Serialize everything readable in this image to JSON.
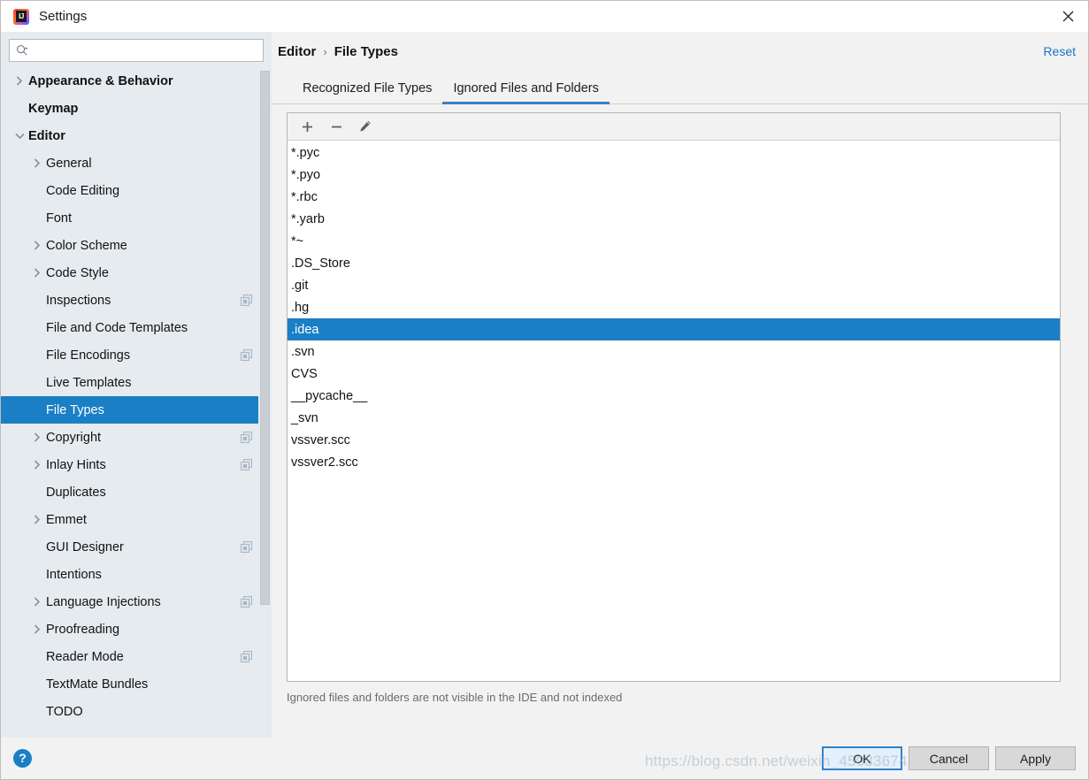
{
  "window": {
    "title": "Settings",
    "logo_icon": "intellij-idea-logo",
    "close_icon": "close-icon"
  },
  "sidebar": {
    "search": {
      "placeholder": "",
      "value": "",
      "icon": "search-icon"
    },
    "items": [
      {
        "label": "Appearance & Behavior",
        "level": 0,
        "chevron": "right",
        "bold": true,
        "selected": false,
        "badge": false
      },
      {
        "label": "Keymap",
        "level": 0,
        "chevron": "none",
        "bold": true,
        "selected": false,
        "badge": false
      },
      {
        "label": "Editor",
        "level": 0,
        "chevron": "down",
        "bold": true,
        "selected": false,
        "badge": false
      },
      {
        "label": "General",
        "level": 1,
        "chevron": "right",
        "bold": false,
        "selected": false,
        "badge": false
      },
      {
        "label": "Code Editing",
        "level": 1,
        "chevron": "none",
        "bold": false,
        "selected": false,
        "badge": false
      },
      {
        "label": "Font",
        "level": 1,
        "chevron": "none",
        "bold": false,
        "selected": false,
        "badge": false
      },
      {
        "label": "Color Scheme",
        "level": 1,
        "chevron": "right",
        "bold": false,
        "selected": false,
        "badge": false
      },
      {
        "label": "Code Style",
        "level": 1,
        "chevron": "right",
        "bold": false,
        "selected": false,
        "badge": false
      },
      {
        "label": "Inspections",
        "level": 1,
        "chevron": "none",
        "bold": false,
        "selected": false,
        "badge": true
      },
      {
        "label": "File and Code Templates",
        "level": 1,
        "chevron": "none",
        "bold": false,
        "selected": false,
        "badge": false
      },
      {
        "label": "File Encodings",
        "level": 1,
        "chevron": "none",
        "bold": false,
        "selected": false,
        "badge": true
      },
      {
        "label": "Live Templates",
        "level": 1,
        "chevron": "none",
        "bold": false,
        "selected": false,
        "badge": false
      },
      {
        "label": "File Types",
        "level": 1,
        "chevron": "none",
        "bold": false,
        "selected": true,
        "badge": false
      },
      {
        "label": "Copyright",
        "level": 1,
        "chevron": "right",
        "bold": false,
        "selected": false,
        "badge": true
      },
      {
        "label": "Inlay Hints",
        "level": 1,
        "chevron": "right",
        "bold": false,
        "selected": false,
        "badge": true
      },
      {
        "label": "Duplicates",
        "level": 1,
        "chevron": "none",
        "bold": false,
        "selected": false,
        "badge": false
      },
      {
        "label": "Emmet",
        "level": 1,
        "chevron": "right",
        "bold": false,
        "selected": false,
        "badge": false
      },
      {
        "label": "GUI Designer",
        "level": 1,
        "chevron": "none",
        "bold": false,
        "selected": false,
        "badge": true
      },
      {
        "label": "Intentions",
        "level": 1,
        "chevron": "none",
        "bold": false,
        "selected": false,
        "badge": false
      },
      {
        "label": "Language Injections",
        "level": 1,
        "chevron": "right",
        "bold": false,
        "selected": false,
        "badge": true
      },
      {
        "label": "Proofreading",
        "level": 1,
        "chevron": "right",
        "bold": false,
        "selected": false,
        "badge": false
      },
      {
        "label": "Reader Mode",
        "level": 1,
        "chevron": "none",
        "bold": false,
        "selected": false,
        "badge": true
      },
      {
        "label": "TextMate Bundles",
        "level": 1,
        "chevron": "none",
        "bold": false,
        "selected": false,
        "badge": false
      },
      {
        "label": "TODO",
        "level": 1,
        "chevron": "none",
        "bold": false,
        "selected": false,
        "badge": false
      }
    ],
    "help_button": {
      "label": "?",
      "icon": "help-icon"
    }
  },
  "main": {
    "breadcrumb": {
      "root": "Editor",
      "separator": "›",
      "current": "File Types"
    },
    "reset_label": "Reset",
    "tabs": [
      {
        "label": "Recognized File Types",
        "active": false
      },
      {
        "label": "Ignored Files and Folders",
        "active": true
      }
    ],
    "toolbar": [
      {
        "name": "add-button",
        "icon": "plus-icon"
      },
      {
        "name": "remove-button",
        "icon": "minus-icon"
      },
      {
        "name": "edit-button",
        "icon": "pencil-icon"
      }
    ],
    "list": {
      "items": [
        {
          "value": "*.pyc",
          "selected": false
        },
        {
          "value": "*.pyo",
          "selected": false
        },
        {
          "value": "*.rbc",
          "selected": false
        },
        {
          "value": "*.yarb",
          "selected": false
        },
        {
          "value": "*~",
          "selected": false
        },
        {
          "value": ".DS_Store",
          "selected": false
        },
        {
          "value": ".git",
          "selected": false
        },
        {
          "value": ".hg",
          "selected": false
        },
        {
          "value": ".idea",
          "selected": true
        },
        {
          "value": ".svn",
          "selected": false
        },
        {
          "value": "CVS",
          "selected": false
        },
        {
          "value": "__pycache__",
          "selected": false
        },
        {
          "value": "_svn",
          "selected": false
        },
        {
          "value": "vssver.scc",
          "selected": false
        },
        {
          "value": "vssver2.scc",
          "selected": false
        }
      ]
    },
    "hint": "Ignored files and folders are not visible in the IDE and not indexed"
  },
  "footer": {
    "ok_label": "OK",
    "cancel_label": "Cancel",
    "apply_label": "Apply"
  },
  "watermark": "https://blog.csdn.net/weixin_45033674",
  "colors": {
    "accent": "#1a7fc4",
    "link": "#1b73c4",
    "sidebar_bg": "#e6ebef",
    "panel_bg": "#f2f2f2",
    "tab_underline": "#3d7fc0"
  }
}
